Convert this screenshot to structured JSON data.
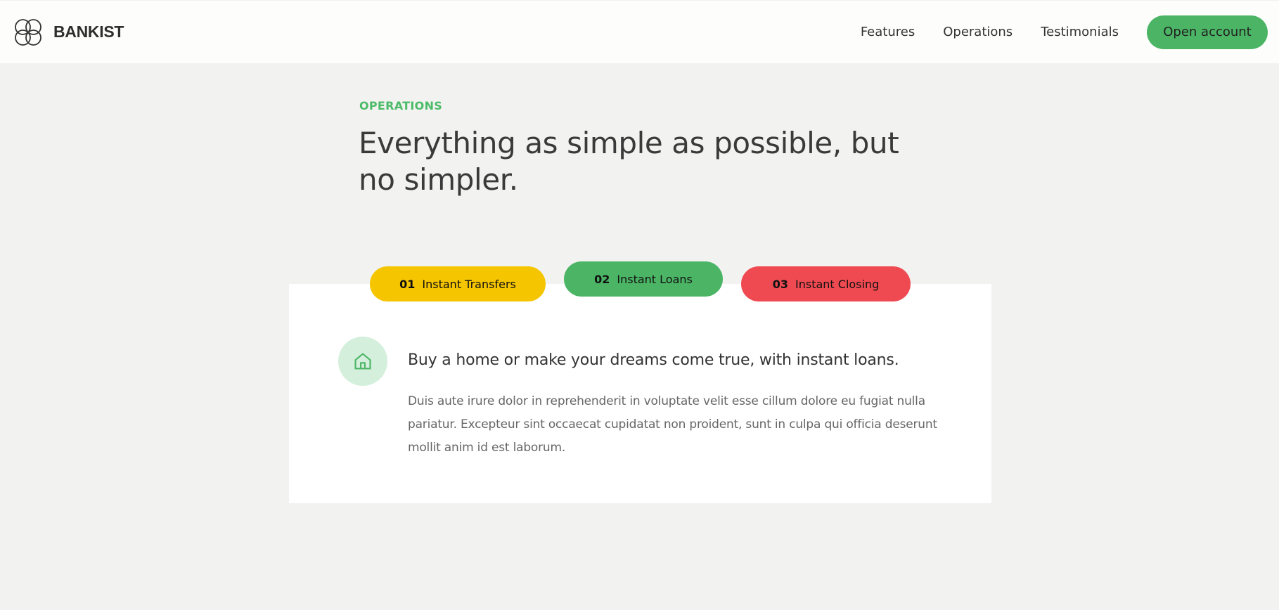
{
  "brand": {
    "name": "BANKIST",
    "icon": "logo-rings-icon"
  },
  "nav": {
    "links": [
      "Features",
      "Operations",
      "Testimonials"
    ],
    "cta": "Open account"
  },
  "section": {
    "tag": "OPERATIONS",
    "title": "Everything as simple as possible, but no simpler."
  },
  "tabs": [
    {
      "num": "01",
      "label": "Instant Transfers",
      "color": "#f5c500"
    },
    {
      "num": "02",
      "label": "Instant Loans",
      "color": "#4bb565",
      "active": true
    },
    {
      "num": "03",
      "label": "Instant Closing",
      "color": "#ef4a51"
    }
  ],
  "content": {
    "icon": "home-icon",
    "heading": "Buy a home or make your dreams come true, with instant loans.",
    "text": "Duis aute irure dolor in reprehenderit in voluptate velit esse cillum dolore eu fugiat nulla pariatur. Excepteur sint occaecat cupidatat non proident, sunt in culpa qui officia deserunt mollit anim id est laborum."
  },
  "colors": {
    "accent": "#4bb565",
    "background": "#f2f2f1"
  }
}
